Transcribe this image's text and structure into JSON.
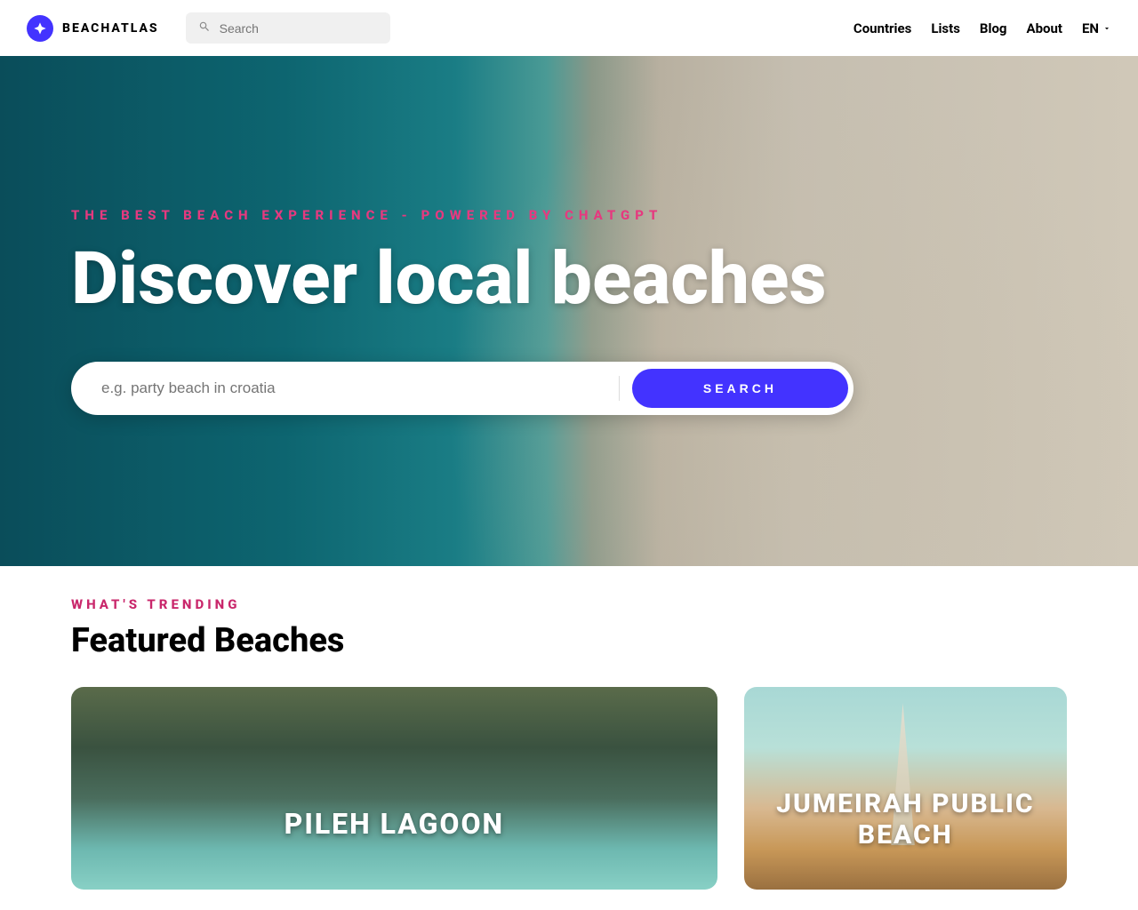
{
  "header": {
    "brand": "BEACHATLAS",
    "search_placeholder": "Search",
    "nav": [
      "Countries",
      "Lists",
      "Blog",
      "About"
    ],
    "lang": "EN"
  },
  "hero": {
    "eyebrow": "THE BEST BEACH EXPERIENCE - POWERED BY CHATGPT",
    "title": "Discover local beaches",
    "search_placeholder": "e.g. party beach in croatia",
    "search_button": "SEARCH"
  },
  "trending": {
    "eyebrow": "WHAT'S TRENDING",
    "title": "Featured Beaches",
    "cards": [
      {
        "title": "PILEH LAGOON"
      },
      {
        "title": "JUMEIRAH PUBLIC BEACH"
      }
    ]
  }
}
